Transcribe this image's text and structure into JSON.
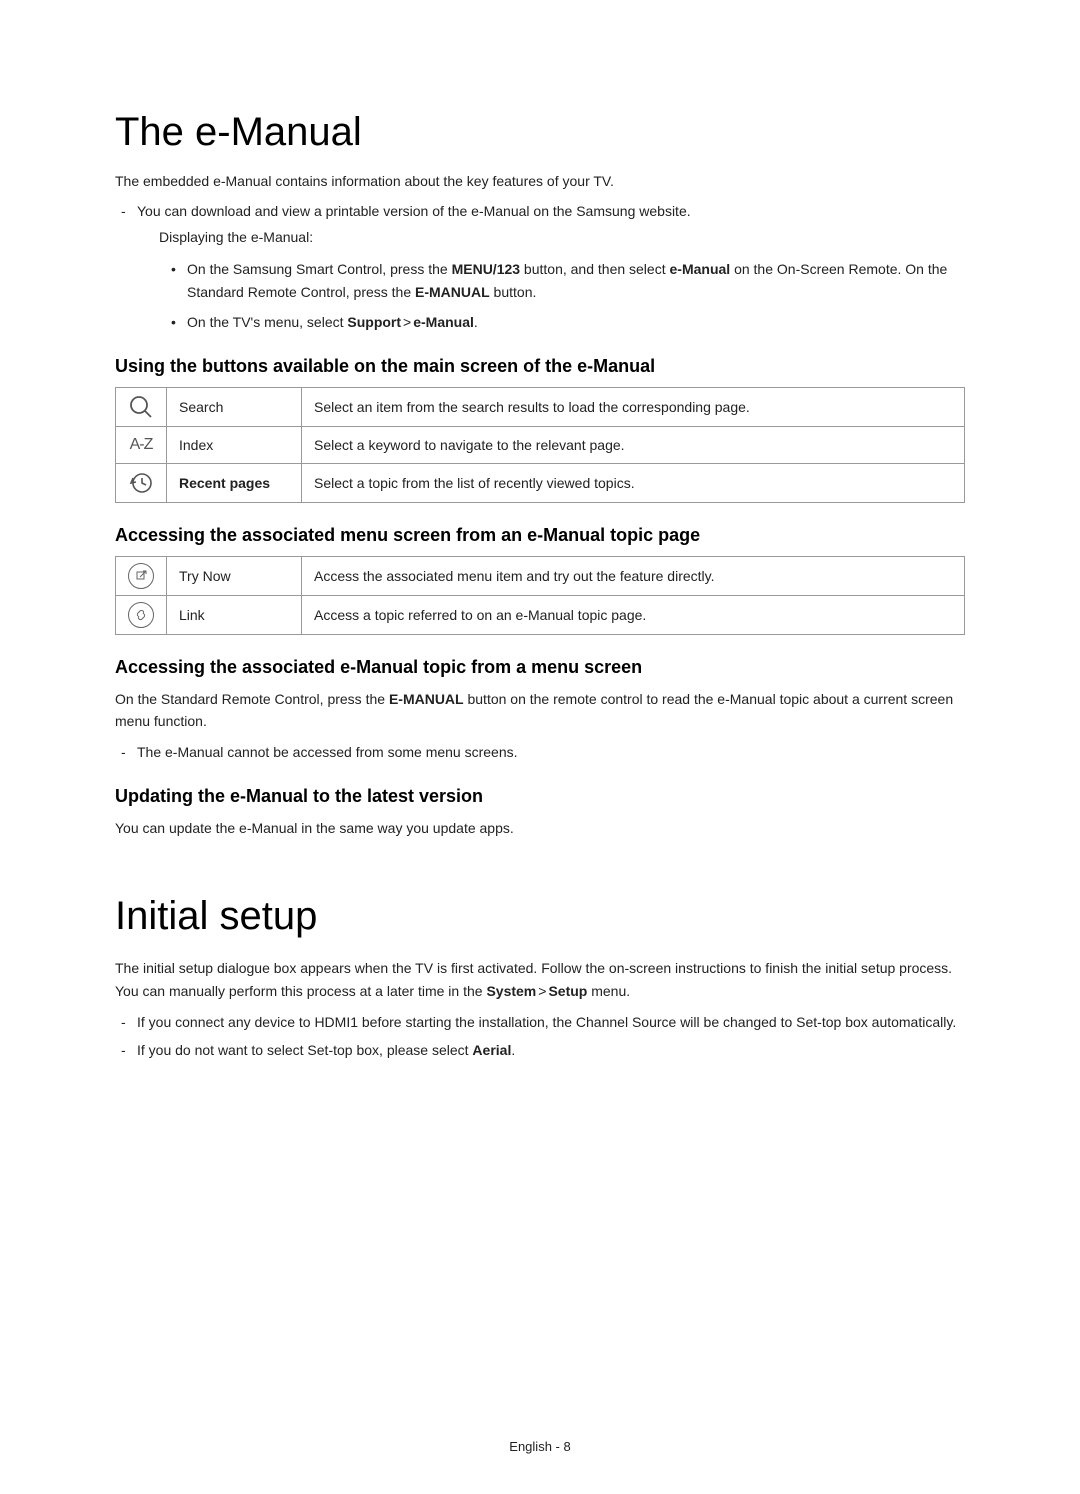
{
  "section1": {
    "title": "The e-Manual",
    "intro": "The embedded e-Manual contains information about the key features of your TV.",
    "download_note": "You can download and view a printable version of the e-Manual on the Samsung website.",
    "displaying_label": "Displaying the e-Manual:",
    "bullet1_pre": "On the Samsung Smart Control, press the ",
    "bullet1_kw1": "MENU/123",
    "bullet1_mid": " button, and then select ",
    "bullet1_kw2": "e-Manual",
    "bullet1_post": " on the On-Screen Remote. On the Standard Remote Control, press the ",
    "bullet1_kw3": "E-MANUAL",
    "bullet1_end": " button.",
    "bullet2_pre": "On the TV's menu, select ",
    "bullet2_kw1": "Support",
    "bullet2_gt": " > ",
    "bullet2_kw2": "e-Manual",
    "bullet2_end": ".",
    "sub1": {
      "heading": "Using the buttons available on the main screen of the e-Manual",
      "rows": [
        {
          "label": "Search",
          "desc": "Select an item from the search results to load the corresponding page."
        },
        {
          "label": "Index",
          "desc": "Select a keyword to navigate to the relevant page."
        },
        {
          "label": "Recent pages",
          "desc": "Select a topic from the list of recently viewed topics."
        }
      ]
    },
    "sub2": {
      "heading": "Accessing the associated menu screen from an e-Manual topic page",
      "rows": [
        {
          "label": "Try Now",
          "desc": "Access the associated menu item and try out the feature directly."
        },
        {
          "label": "Link",
          "desc": "Access a topic referred to on an e-Manual topic page."
        }
      ]
    },
    "sub3": {
      "heading": "Accessing the associated e-Manual topic from a menu screen",
      "body_pre": "On the Standard Remote Control, press the ",
      "body_kw": "E-MANUAL",
      "body_post": " button on the remote control to read the e-Manual topic about a current screen menu function.",
      "note": "The e-Manual cannot be accessed from some menu screens."
    },
    "sub4": {
      "heading": "Updating the e-Manual to the latest version",
      "body": "You can update the e-Manual in the same way you update apps."
    }
  },
  "section2": {
    "title": "Initial setup",
    "body_pre": "The initial setup dialogue box appears when the TV is first activated. Follow the on-screen instructions to finish the initial setup process. You can manually perform this process at a later time in the ",
    "kw1": "System",
    "gt": " > ",
    "kw2": "Setup",
    "body_post": " menu.",
    "note1": "If you connect any device to HDMI1 before starting the installation, the Channel Source will be changed to Set-top box automatically.",
    "note2_pre": "If you do not want to select Set-top box, please select ",
    "note2_kw": "Aerial",
    "note2_post": "."
  },
  "footer": {
    "lang": "English",
    "sep": " - ",
    "page": "8"
  }
}
